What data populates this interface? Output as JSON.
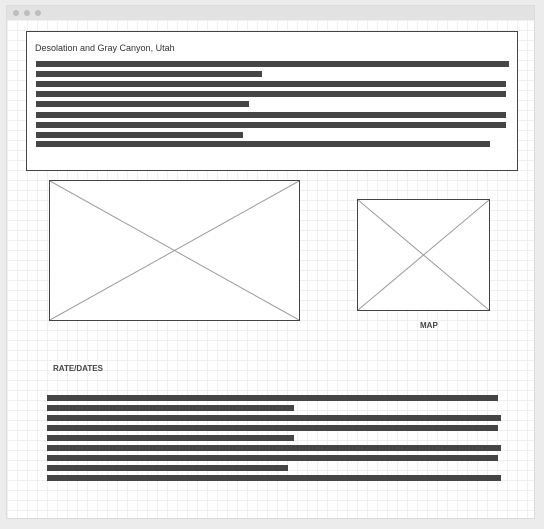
{
  "window": {
    "controls": [
      "window-dot",
      "window-dot",
      "window-dot"
    ]
  },
  "header": {
    "title": "Desolation and Gray Canyon, Utah"
  },
  "map": {
    "label": "MAP"
  },
  "rates": {
    "heading": "RATE/DATES"
  },
  "colors": {
    "placeholder_line": "#9a9a9a",
    "text_bar": "#454545"
  }
}
